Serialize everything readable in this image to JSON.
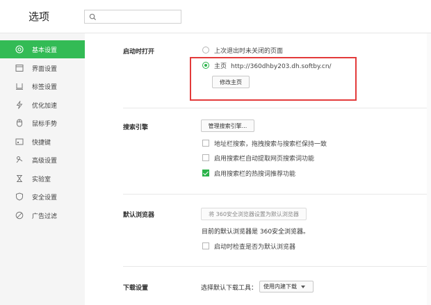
{
  "header": {
    "title": "选项",
    "search": {
      "value": "",
      "placeholder": ""
    }
  },
  "sidebar": {
    "items": [
      {
        "label": "基本设置",
        "icon": "settings-icon",
        "active": true
      },
      {
        "label": "界面设置",
        "icon": "window-icon"
      },
      {
        "label": "标签设置",
        "icon": "tab-icon"
      },
      {
        "label": "优化加速",
        "icon": "lightning-icon"
      },
      {
        "label": "鼠标手势",
        "icon": "mouse-icon"
      },
      {
        "label": "快捷键",
        "icon": "keyboard-icon"
      },
      {
        "label": "高级设置",
        "icon": "advanced-icon"
      },
      {
        "label": "实验室",
        "icon": "lab-icon"
      },
      {
        "label": "安全设置",
        "icon": "shield-icon"
      },
      {
        "label": "广告过滤",
        "icon": "block-icon"
      }
    ]
  },
  "startup": {
    "title": "启动时打开",
    "option_last": "上次退出时未关闭的页面",
    "option_home": "主页",
    "home_url": "http://360dhby203.dh.softby.cn/",
    "edit_home_button": "修改主页"
  },
  "search_engine": {
    "title": "搜索引擎",
    "manage_button": "管理搜索引擎...",
    "options": [
      {
        "label": "地址栏搜索，拖拽搜索与搜索栏保持一致",
        "checked": false
      },
      {
        "label": "启用搜索栏自动提取网页搜索词功能",
        "checked": false
      },
      {
        "label": "启用搜索栏的热搜词推荐功能",
        "checked": true
      }
    ]
  },
  "default_browser": {
    "title": "默认浏览器",
    "set_default_button": "将 360安全浏览器设置为默认浏览器",
    "status_text": "目前的默认浏览器是 360安全浏览器。",
    "check_on_startup": "启动时检查是否为默认浏览器"
  },
  "download": {
    "title": "下载设置",
    "tool_label": "选择默认下载工具：",
    "tool_value": "使用内建下载"
  },
  "colors": {
    "accent": "#33bb55",
    "highlight": "#e33a3a"
  }
}
